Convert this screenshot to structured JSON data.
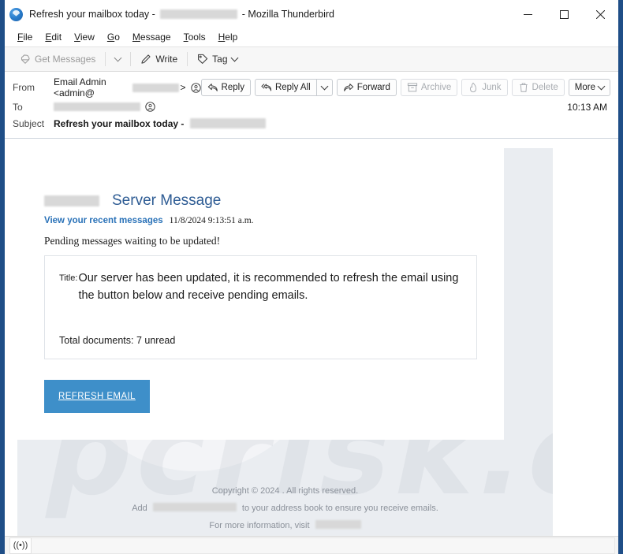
{
  "window": {
    "title_prefix": "Refresh your mailbox today -",
    "title_redacted": "[redacted domain]",
    "title_suffix": "- Mozilla Thunderbird",
    "logo_icon": "thunderbird-logo-icon",
    "frame_color": "#1f4e87",
    "controls": {
      "minimize": "minimize-icon",
      "maximize": "maximize-icon",
      "close": "close-icon"
    }
  },
  "menubar": {
    "items": [
      {
        "label": "File",
        "access": "F"
      },
      {
        "label": "Edit",
        "access": "E"
      },
      {
        "label": "View",
        "access": "V"
      },
      {
        "label": "Go",
        "access": "G"
      },
      {
        "label": "Message",
        "access": "M"
      },
      {
        "label": "Tools",
        "access": "T"
      },
      {
        "label": "Help",
        "access": "H"
      }
    ]
  },
  "toolbar": {
    "get_messages_label": "Get Messages",
    "get_messages_icon": "download-mail-icon",
    "get_messages_dropdown_icon": "chevron-down-icon",
    "write_label": "Write",
    "write_icon": "pencil-icon",
    "tag_label": "Tag",
    "tag_icon": "tag-icon",
    "tag_dropdown_icon": "chevron-down-icon"
  },
  "message_header": {
    "from_label": "From",
    "from_value": "Email Admin <admin@",
    "from_domain_redacted": "[redacted]",
    "from_value_end": ">",
    "from_contact_icon": "contact-avatar-icon",
    "to_label": "To",
    "to_value_redacted": "[redacted recipient]",
    "to_contact_icon": "contact-avatar-icon",
    "subject_label": "Subject",
    "subject_value": "Refresh your mailbox today -",
    "subject_redacted": "[redacted domain]",
    "time": "10:13 AM",
    "actions": [
      {
        "label": "Reply",
        "icon": "reply-icon",
        "disabled": false,
        "dropdown": false
      },
      {
        "label": "Reply All",
        "icon": "reply-all-icon",
        "disabled": false,
        "dropdown": true
      },
      {
        "label": "Forward",
        "icon": "forward-icon",
        "disabled": false,
        "dropdown": false
      },
      {
        "label": "Archive",
        "icon": "archive-box-icon",
        "disabled": true,
        "dropdown": false
      },
      {
        "label": "Junk",
        "icon": "junk-flame-icon",
        "disabled": true,
        "dropdown": false
      },
      {
        "label": "Delete",
        "icon": "trash-icon",
        "disabled": true,
        "dropdown": false
      },
      {
        "label": "More",
        "icon": "",
        "disabled": false,
        "dropdown": true
      }
    ]
  },
  "email": {
    "brand_logo_redacted": "[redacted logo]",
    "heading": "Server Message",
    "recent_link": "View your recent messages",
    "timestamp": "11/8/2024 9:13:51 a.m.",
    "pending_line": "Pending messages waiting to be updated!",
    "title_label": "Title:",
    "title_text": "Our server has been updated, it is recommended to refresh the email using the button below and receive pending emails.",
    "total_documents": "Total documents: 7 unread",
    "cta_label": "REFRESH EMAIL",
    "cta_color": "#3e8fc9",
    "heading_color": "#2e5c94",
    "link_color": "#2a72b8",
    "watermark_text": "pcrisk.com",
    "footer": {
      "copyright": "Copyright © 2024 . All rights reserved.",
      "address_prefix": "Add",
      "address_redacted": "[redacted sender address]",
      "address_suffix": "to your address book to ensure you receive emails.",
      "more_info_prefix": "For more information, visit",
      "more_info_redacted": "[redacted url]"
    }
  },
  "statusbar": {
    "icon": "broadcast-antenna-icon",
    "icon_glyph": "((•))"
  }
}
